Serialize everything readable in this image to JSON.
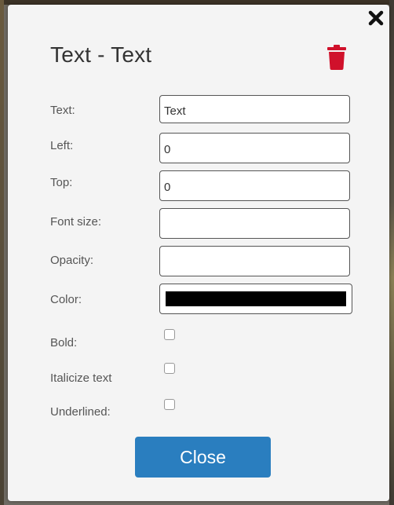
{
  "dialog": {
    "title": "Text - Text",
    "close_icon": "close-x-icon",
    "delete_icon": "trash-icon",
    "delete_color": "#d0112b"
  },
  "fields": {
    "text": {
      "label": "Text:",
      "value": "Text"
    },
    "left": {
      "label": "Left:",
      "value": "0"
    },
    "top": {
      "label": "Top:",
      "value": "0"
    },
    "font_size": {
      "label": "Font size:",
      "value": ""
    },
    "opacity": {
      "label": "Opacity:",
      "value": ""
    },
    "color": {
      "label": "Color:",
      "value": "#000000"
    }
  },
  "checkboxes": {
    "bold": {
      "label": "Bold:",
      "checked": false
    },
    "italic": {
      "label": "Italicize text",
      "checked": false
    },
    "underline": {
      "label": "Underlined:",
      "checked": false
    }
  },
  "buttons": {
    "close_label": "Close",
    "close_color": "#2a7ebf"
  }
}
